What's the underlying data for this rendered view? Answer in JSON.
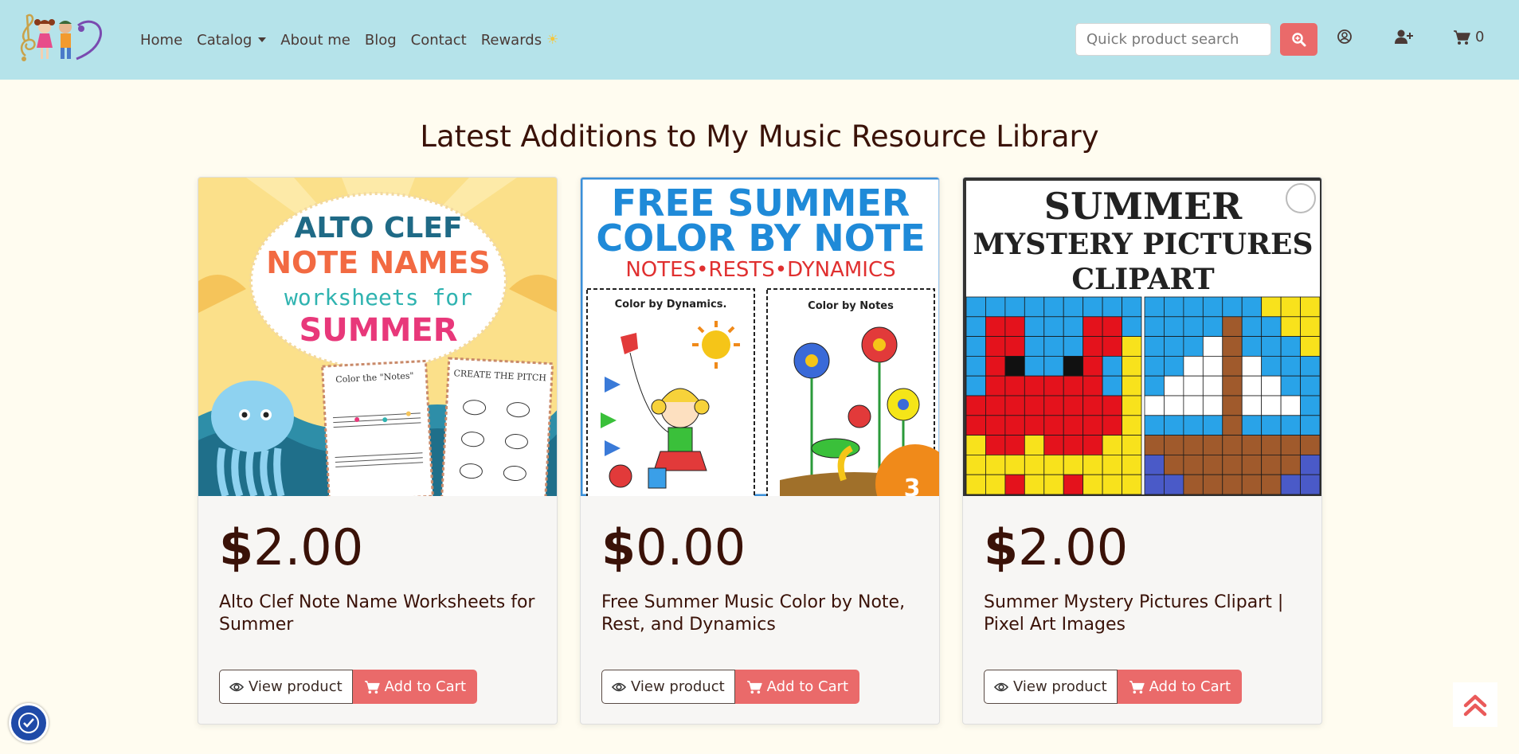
{
  "navbar": {
    "links": [
      {
        "label": "Home"
      },
      {
        "label": "Catalog"
      },
      {
        "label": "About me"
      },
      {
        "label": "Blog"
      },
      {
        "label": "Contact"
      },
      {
        "label": "Rewards"
      }
    ],
    "search_placeholder": "Quick product search",
    "cart_count": "0"
  },
  "page_title": "Latest Additions to My Music Resource Library",
  "products": [
    {
      "price": "2.00",
      "title": "Alto Clef Note Name Worksheets for Summer",
      "view_label": "View product",
      "cart_label": "Add to Cart",
      "image": {
        "line1": "ALTO CLEF",
        "line2": "NOTE NAMES",
        "line3": "worksheets for",
        "line4": "SUMMER",
        "sheet1": "Color the \"Notes\"",
        "sheet2": "CREATE THE PITCH"
      }
    },
    {
      "price": "0.00",
      "title": "Free Summer Music Color by Note, Rest, and Dynamics",
      "view_label": "View product",
      "cart_label": "Add to Cart",
      "image": {
        "line1": "FREE SUMMER",
        "line2": "COLOR BY NOTE",
        "line3": "NOTES•RESTS•DYNAMICS",
        "sheet1": "Color by Dynamics.",
        "sheet2": "Color by Notes",
        "badge": "3"
      }
    },
    {
      "price": "2.00",
      "title": "Summer Mystery Pictures Clipart | Pixel Art Images",
      "view_label": "View product",
      "cart_label": "Add to Cart",
      "image": {
        "line1": "SUMMER",
        "line2": "MYSTERY PICTURES",
        "line3": "CLIPART"
      }
    }
  ],
  "colors": {
    "navbar_bg": "#b5e3ea",
    "page_bg": "#fffcf0",
    "accent": "#ea6a6a",
    "text_dark": "#3a1208",
    "a11y_button": "#1f4aa8"
  }
}
